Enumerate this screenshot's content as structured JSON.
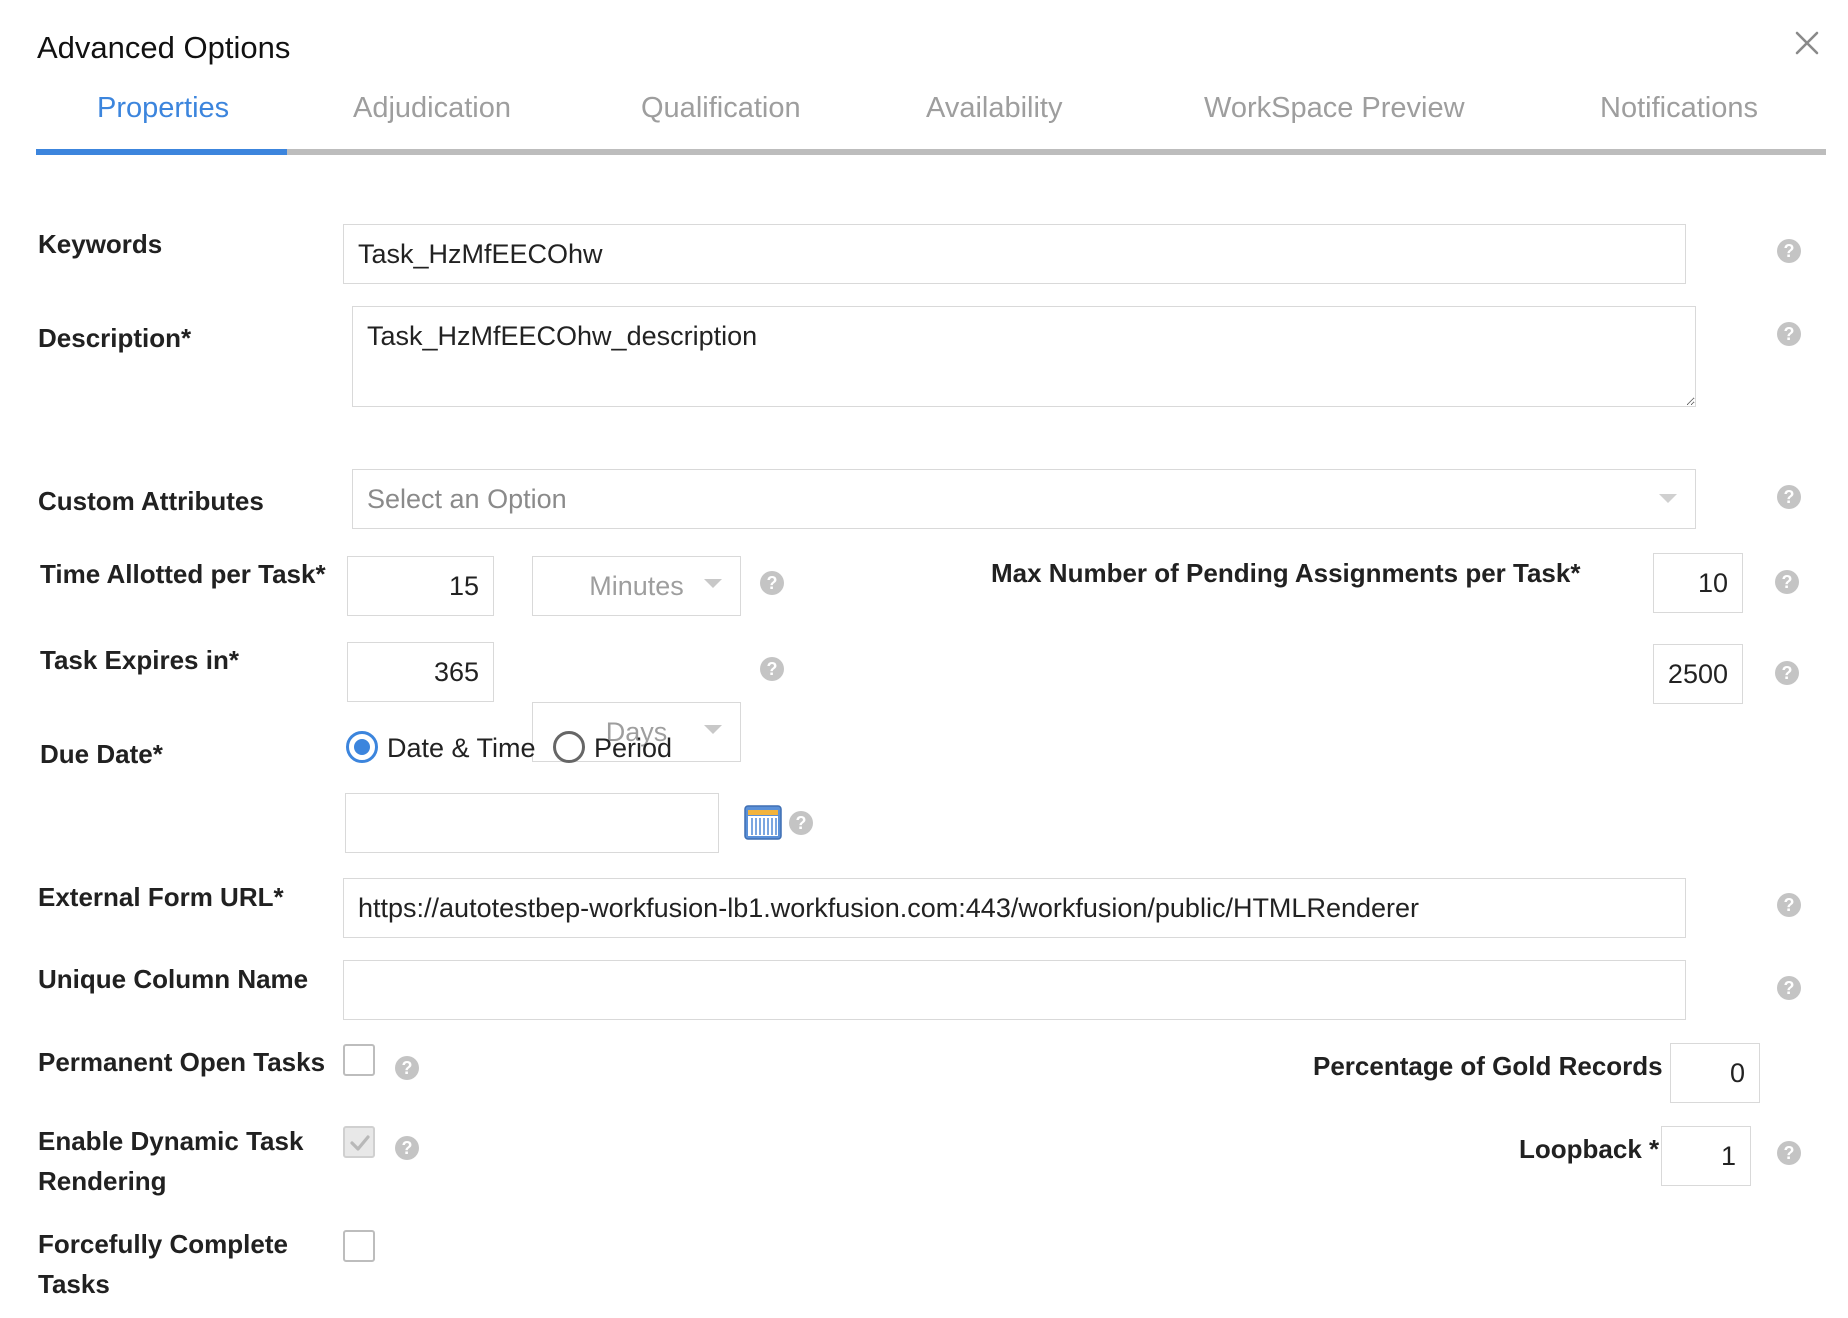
{
  "dialog": {
    "title": "Advanced Options"
  },
  "tabs": [
    {
      "label": "Properties",
      "active": true
    },
    {
      "label": "Adjudication",
      "active": false
    },
    {
      "label": "Qualification",
      "active": false
    },
    {
      "label": "Availability",
      "active": false
    },
    {
      "label": "WorkSpace Preview",
      "active": false
    },
    {
      "label": "Notifications",
      "active": false
    }
  ],
  "colors": {
    "accent": "#3c85dd",
    "tab_inactive": "#9e9e9e",
    "help_icon": "#c4c4c4"
  },
  "form": {
    "keywords": {
      "label": "Keywords",
      "value": "Task_HzMfEECOhw"
    },
    "description": {
      "label": "Description*",
      "value": "Task_HzMfEECOhw_description"
    },
    "custom_attributes": {
      "label": "Custom Attributes",
      "placeholder": "Select an Option"
    },
    "time_allotted": {
      "label": "Time Allotted per Task*",
      "value": "15",
      "unit": "Minutes"
    },
    "max_pending": {
      "label": "Max Number of Pending Assignments per Task*",
      "value": "10"
    },
    "task_expires": {
      "label": "Task Expires in*",
      "value": "365",
      "unit": "Days"
    },
    "extra_value": {
      "value": "2500"
    },
    "due_date": {
      "label": "Due Date*",
      "option_datetime": "Date & Time",
      "option_period": "Period",
      "selected": "Date & Time",
      "value": ""
    },
    "external_form_url": {
      "label": "External Form URL*",
      "value": "https://autotestbep-workfusion-lb1.workfusion.com:443/workfusion/public/HTMLRenderer"
    },
    "unique_column_name": {
      "label": "Unique Column Name",
      "value": ""
    },
    "permanent_open_tasks": {
      "label": "Permanent Open Tasks",
      "checked": false
    },
    "gold_records": {
      "label": "Percentage of Gold Records *",
      "value": "0"
    },
    "dynamic_rendering": {
      "label": "Enable Dynamic Task Rendering",
      "checked": true,
      "disabled": true
    },
    "loopback": {
      "label": "Loopback *",
      "value": "1"
    },
    "forcefully_complete": {
      "label": "Forcefully Complete Tasks",
      "checked": false
    }
  },
  "icons": {
    "help": "?",
    "close": "close-icon",
    "calendar": "calendar-icon",
    "check": "check-icon"
  }
}
